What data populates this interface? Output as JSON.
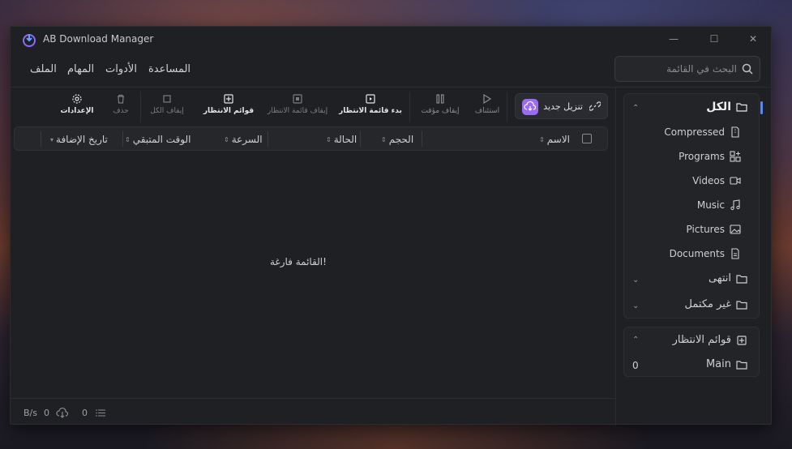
{
  "app": {
    "title": "AB Download Manager"
  },
  "window_controls": {
    "minimize": "—",
    "maximize": "☐",
    "close": "✕"
  },
  "menu": {
    "file": "الملف",
    "tasks": "المهام",
    "tools": "الأدوات",
    "help": "المساعدة"
  },
  "search": {
    "placeholder": "البحث في القائمة"
  },
  "toolbar": {
    "new_download": "تنزيل جديد",
    "resume": "استئناف",
    "pause": "إيقاف مؤقت",
    "start_queue": "بدء قائمة الانتظار",
    "stop_queue": "إيقاف قائمة الانتظار",
    "queues": "قوائم الانتظار",
    "stop_all": "إيقاف الكل",
    "delete": "حذف",
    "settings": "الإعدادات"
  },
  "table": {
    "columns": [
      "الاسم",
      "الحجم",
      "الحالة",
      "السرعة",
      "الوقت المتبقي",
      "تاريخ الإضافة"
    ],
    "empty_message": "القائمة فارغة!"
  },
  "sidebar": {
    "all": "الكل",
    "categories": [
      "Compressed",
      "Programs",
      "Videos",
      "Music",
      "Pictures",
      "Documents"
    ],
    "finished": "انتهى",
    "unfinished": "غير مكتمل",
    "queues_title": "قوائم الانتظار",
    "queue_main": "Main",
    "queue_main_count": "0"
  },
  "status": {
    "speed_unit": "B/s",
    "speed_value": "0",
    "active_count": "0"
  },
  "colors": {
    "accent": "#5a8be8",
    "new_download_icon": "#9b6bf0"
  }
}
